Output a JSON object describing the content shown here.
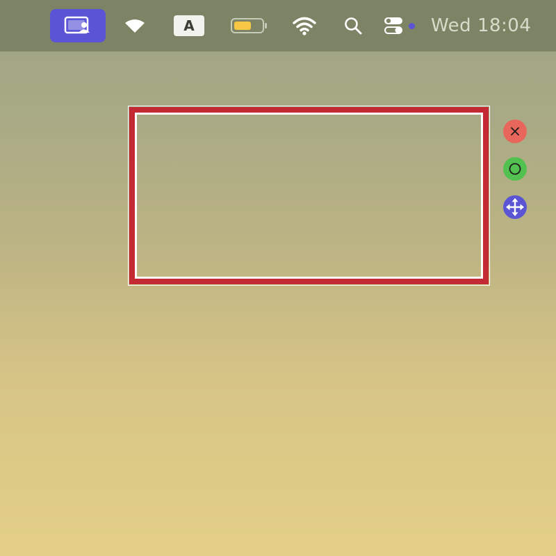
{
  "menubar": {
    "items": [
      {
        "id": "screen-share",
        "icon": "screen-share-icon",
        "active": true,
        "accent": "#5b55d6"
      },
      {
        "id": "wifi-alt",
        "icon": "wifi-wedge-icon"
      },
      {
        "id": "input-source",
        "label": "A"
      },
      {
        "id": "battery",
        "icon": "battery-icon",
        "fill_color": "#f5c745"
      },
      {
        "id": "wifi",
        "icon": "wifi-icon"
      },
      {
        "id": "search",
        "icon": "search-icon"
      },
      {
        "id": "control-center",
        "icon": "toggles-icon",
        "indicator_color": "#5b55d6"
      }
    ],
    "clock": "Wed 18:04"
  },
  "selection": {
    "border_color": "#c42a33",
    "inner_color": "#ffffff"
  },
  "controls": {
    "close": {
      "icon": "close-icon",
      "color": "#e9665c"
    },
    "record": {
      "icon": "circle-icon",
      "color": "#53c14f"
    },
    "move": {
      "icon": "move-arrows-icon",
      "color": "#5b55d6"
    }
  }
}
